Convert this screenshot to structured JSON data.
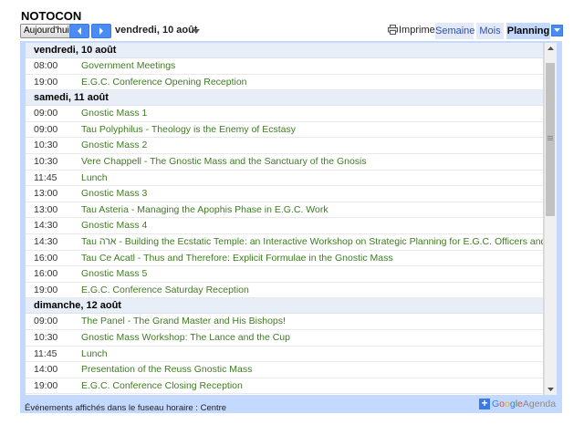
{
  "calendar": {
    "title": "NOTOCON"
  },
  "toolbar": {
    "today_label": "Aujourd'hui",
    "prev_icon": "chevron-left-icon",
    "next_icon": "chevron-right-icon",
    "current_date": "vendredi, 10 août",
    "print_label": "Imprimer",
    "tabs": {
      "week": "Semaine",
      "month": "Mois",
      "agenda": "Planning"
    },
    "active_tab": "Planning"
  },
  "days": [
    {
      "header": "vendredi, 10 août",
      "events": [
        {
          "time": "08:00",
          "title": "Government Meetings"
        },
        {
          "time": "19:00",
          "title": "E.G.C. Conference Opening Reception"
        }
      ]
    },
    {
      "header": "samedi, 11 août",
      "events": [
        {
          "time": "09:00",
          "title": "Gnostic Mass 1"
        },
        {
          "time": "09:00",
          "title": "Tau Polyphilus - Theology is the Enemy of Ecstasy"
        },
        {
          "time": "10:30",
          "title": "Gnostic Mass 2"
        },
        {
          "time": "10:30",
          "title": "Vere Chappell - The Gnostic Mass and the Sanctuary of the Gnosis"
        },
        {
          "time": "11:45",
          "title": "Lunch"
        },
        {
          "time": "13:00",
          "title": "Gnostic Mass 3"
        },
        {
          "time": "13:00",
          "title": "Tau Asteria - Managing the Apophis Phase in E.G.C. Work"
        },
        {
          "time": "14:30",
          "title": "Gnostic Mass 4"
        },
        {
          "time": "14:30",
          "title": "Tau ארה - Building the Ecstatic Temple: an Interactive Workshop on Strategic Planning for E.G.C. Officers and Congregations"
        },
        {
          "time": "16:00",
          "title": "Tau Ce Acatl - Thus and Therefore: Explicit Formulae in the Gnostic Mass"
        },
        {
          "time": "16:00",
          "title": "Gnostic Mass 5"
        },
        {
          "time": "19:00",
          "title": "E.G.C. Conference Saturday Reception"
        }
      ]
    },
    {
      "header": "dimanche, 12 août",
      "events": [
        {
          "time": "09:00",
          "title": "The Panel - The Grand Master and His Bishops!"
        },
        {
          "time": "10:30",
          "title": "Gnostic Mass Workshop: The Lance and the Cup"
        },
        {
          "time": "11:45",
          "title": "Lunch"
        },
        {
          "time": "14:00",
          "title": "Presentation of the Reuss Gnostic Mass"
        },
        {
          "time": "19:00",
          "title": "E.G.C. Conference Closing Reception"
        }
      ]
    }
  ],
  "footer": {
    "timezone_text": "Événements affichés dans le fuseau horaire : Centre",
    "logo": {
      "plus": "+",
      "letters": [
        "G",
        "o",
        "o",
        "g",
        "l",
        "e"
      ],
      "suffix": "Agenda"
    }
  },
  "colors": {
    "event_title": "#3f7b21",
    "accent": "#c3d9ff",
    "day_header_bg": "#e8eef7",
    "nav_button": "#4b8bf4"
  }
}
